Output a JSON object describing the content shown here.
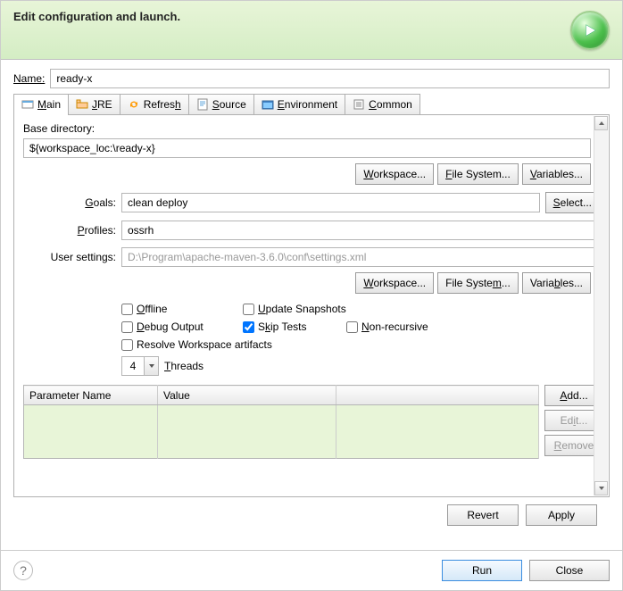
{
  "header": {
    "title": "Edit configuration and launch."
  },
  "name": {
    "label": "Name:",
    "value": "ready-x"
  },
  "tabs": {
    "main": "Main",
    "jre": "JRE",
    "refresh": "Refresh",
    "source": "Source",
    "environment": "Environment",
    "common": "Common"
  },
  "main": {
    "baseDirLabel": "Base directory:",
    "baseDir": "${workspace_loc:\\ready-x}",
    "workspaceBtn": "Workspace...",
    "fileSystemBtn": "File System...",
    "variablesBtn": "Variables...",
    "goalsLabel": "Goals:",
    "goals": "clean deploy",
    "selectBtn": "Select...",
    "profilesLabel": "Profiles:",
    "profiles": "ossrh",
    "userSettingsLabel": "User settings:",
    "userSettings": "D:\\Program\\apache-maven-3.6.0\\conf\\settings.xml",
    "checks": {
      "offline": "Offline",
      "updateSnapshots": "Update Snapshots",
      "debugOutput": "Debug Output",
      "skipTests": "Skip Tests",
      "nonRecursive": "Non-recursive",
      "resolveWorkspace": "Resolve Workspace artifacts"
    },
    "threads": {
      "value": "4",
      "label": "Threads"
    },
    "paramTable": {
      "col1": "Parameter Name",
      "col2": "Value"
    },
    "paramBtns": {
      "add": "Add...",
      "edit": "Edit...",
      "remove": "Remove"
    }
  },
  "actions": {
    "revert": "Revert",
    "apply": "Apply"
  },
  "footer": {
    "run": "Run",
    "close": "Close"
  }
}
